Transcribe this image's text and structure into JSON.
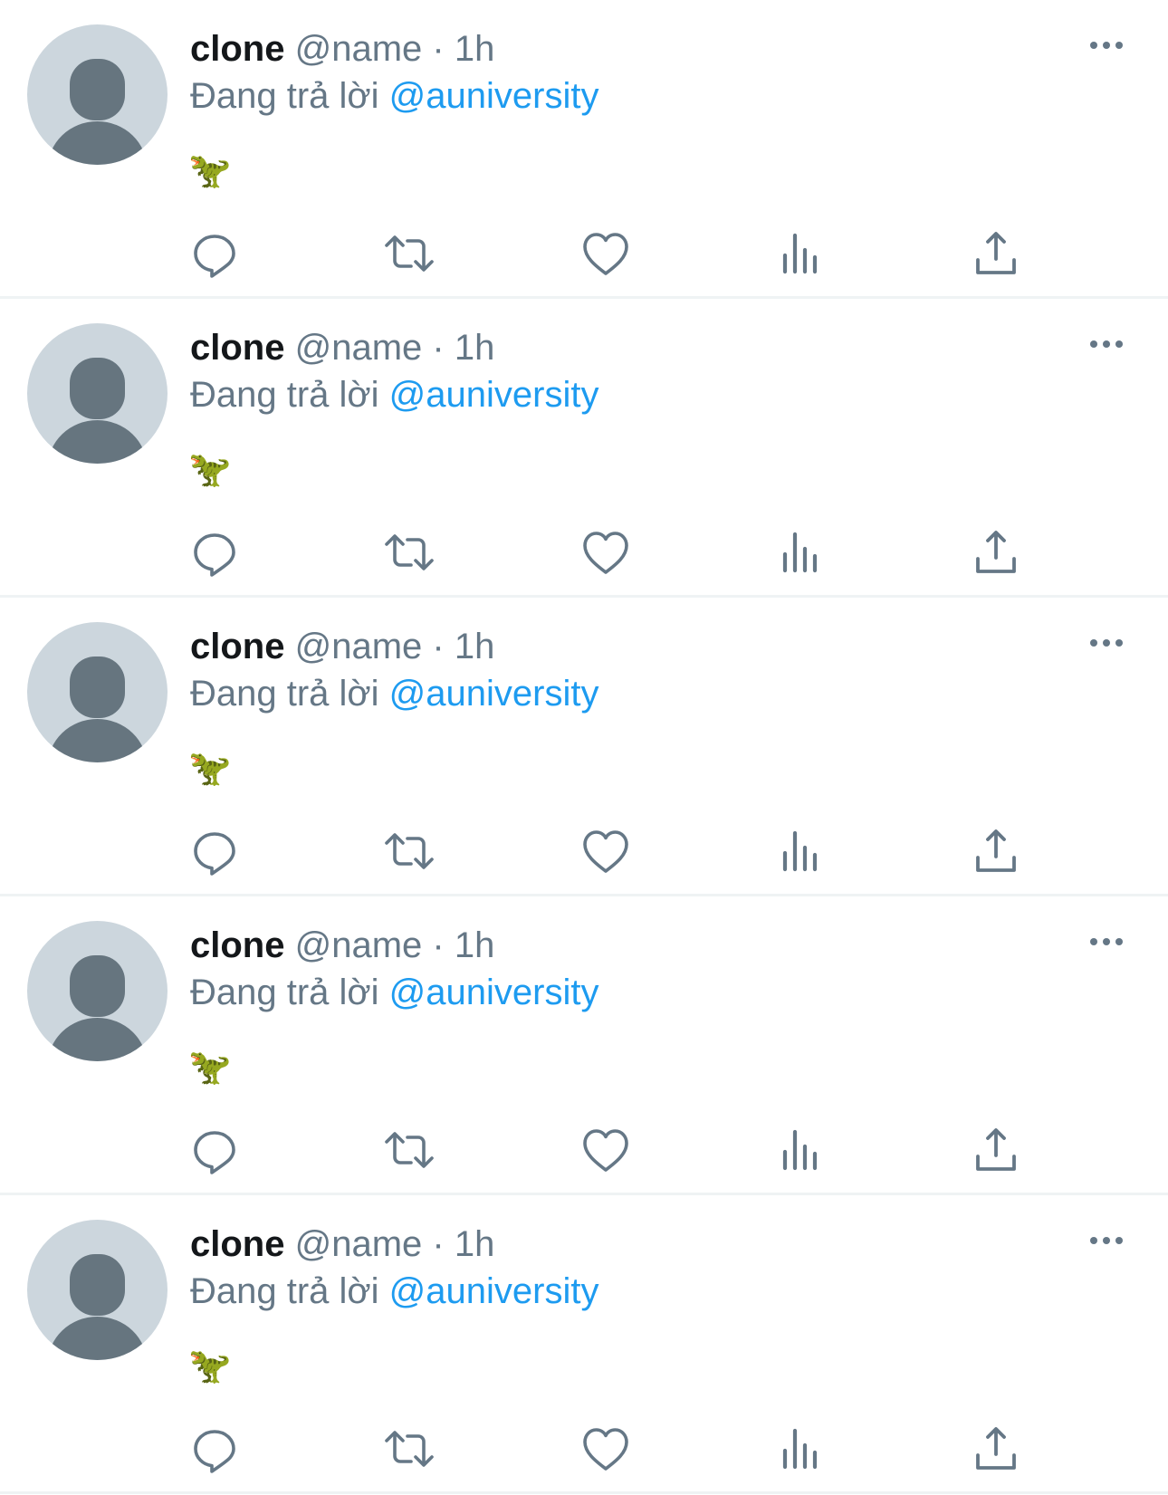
{
  "tweets": [
    {
      "display_name": "clone",
      "handle": "@name",
      "separator": "·",
      "time": "1h",
      "reply_prefix": "Đang trả lời",
      "reply_target": "@auniversity",
      "content": "🦖",
      "actions": [
        "reply-icon",
        "retweet-icon",
        "like-icon",
        "views-icon",
        "share-icon"
      ]
    },
    {
      "display_name": "clone",
      "handle": "@name",
      "separator": "·",
      "time": "1h",
      "reply_prefix": "Đang trả lời",
      "reply_target": "@auniversity",
      "content": "🦖",
      "actions": [
        "reply-icon",
        "retweet-icon",
        "like-icon",
        "views-icon",
        "share-icon"
      ]
    },
    {
      "display_name": "clone",
      "handle": "@name",
      "separator": "·",
      "time": "1h",
      "reply_prefix": "Đang trả lời",
      "reply_target": "@auniversity",
      "content": "🦖",
      "actions": [
        "reply-icon",
        "retweet-icon",
        "like-icon",
        "views-icon",
        "share-icon"
      ]
    },
    {
      "display_name": "clone",
      "handle": "@name",
      "separator": "·",
      "time": "1h",
      "reply_prefix": "Đang trả lời",
      "reply_target": "@auniversity",
      "content": "🦖",
      "actions": [
        "reply-icon",
        "retweet-icon",
        "like-icon",
        "views-icon",
        "share-icon"
      ]
    },
    {
      "display_name": "clone",
      "handle": "@name",
      "separator": "·",
      "time": "1h",
      "reply_prefix": "Đang trả lời",
      "reply_target": "@auniversity",
      "content": "🦖",
      "actions": [
        "reply-icon",
        "retweet-icon",
        "like-icon",
        "views-icon",
        "share-icon"
      ]
    }
  ],
  "colors": {
    "text_primary": "#14171a",
    "text_secondary": "#657786",
    "link": "#1d9bf0",
    "avatar_bg": "#ccd6dd",
    "avatar_fg": "#66757f",
    "icon": "#657786",
    "divider": "#eff3f4"
  }
}
